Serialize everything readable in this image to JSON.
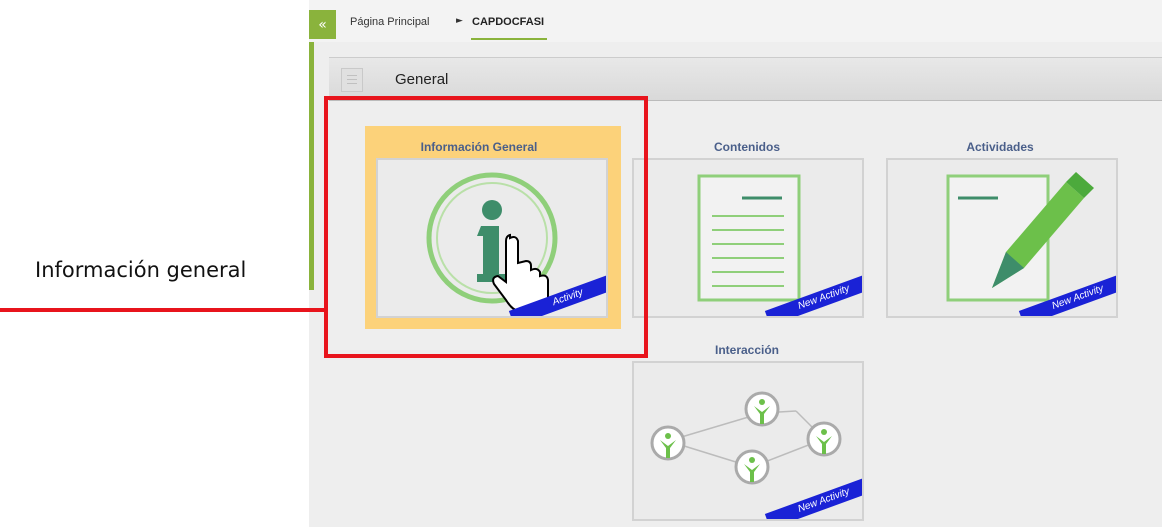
{
  "breadcrumb": {
    "collapse_glyph": "«",
    "home": "Página Principal",
    "separator": "►",
    "current": "CAPDOCFASI"
  },
  "section": {
    "title": "General",
    "icon": "section-menu-icon"
  },
  "tiles": [
    {
      "title": "Información General",
      "badge": "Activity",
      "icon": "info-icon",
      "highlighted": true
    },
    {
      "title": "Contenidos",
      "badge": "New Activity",
      "icon": "document-icon"
    },
    {
      "title": "Actividades",
      "badge": "New Activity",
      "icon": "pencil-icon"
    },
    {
      "title": "Interacción",
      "badge": "New Activity",
      "icon": "network-icon"
    }
  ],
  "annotation": {
    "label": "Información general",
    "color": "#e8141c"
  },
  "colors": {
    "accent": "#8ab33c",
    "highlight": "#fcd27a",
    "tile_title": "#4a5f8a",
    "ribbon": "#1a22d6"
  }
}
